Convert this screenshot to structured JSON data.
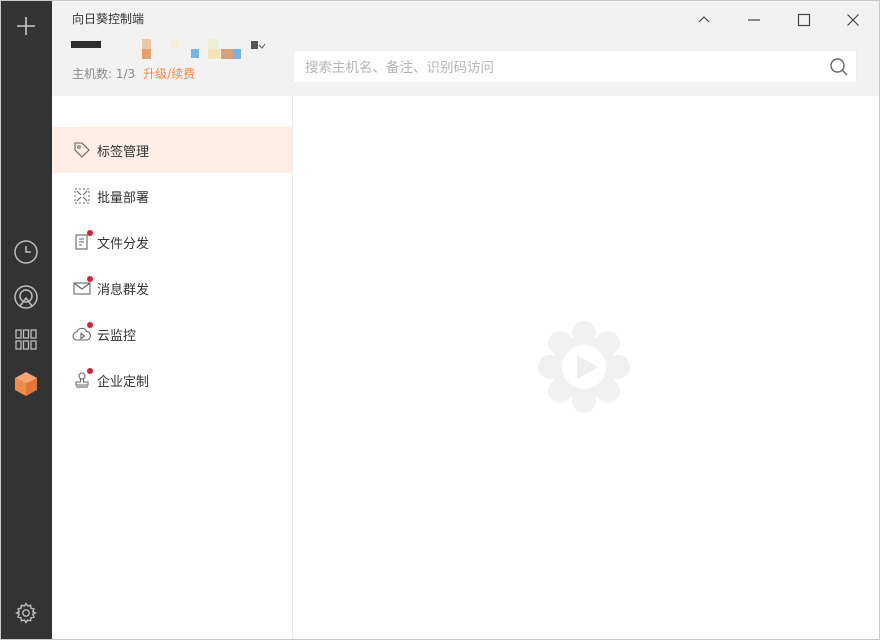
{
  "window": {
    "title": "向日葵控制端"
  },
  "rail": {
    "items": [
      {
        "icon": "plus-icon"
      },
      {
        "icon": "clock-icon"
      },
      {
        "icon": "remote-desktop-icon"
      },
      {
        "icon": "apps-grid-icon"
      },
      {
        "icon": "cube-icon",
        "active": true
      },
      {
        "icon": "gear-icon"
      }
    ],
    "active_color": "#f08d49"
  },
  "header": {
    "host_count_label": "主机数: 1/3",
    "upgrade_label": "升级/续费",
    "search_placeholder": "搜索主机名、备注、识别码访问"
  },
  "menu": {
    "items": [
      {
        "label": "标签管理",
        "icon": "tag-icon",
        "active": true,
        "badge": false
      },
      {
        "label": "批量部署",
        "icon": "batch-deploy-icon",
        "active": false,
        "badge": false
      },
      {
        "label": "文件分发",
        "icon": "file-icon",
        "active": false,
        "badge": true
      },
      {
        "label": "消息群发",
        "icon": "mail-icon",
        "active": false,
        "badge": true
      },
      {
        "label": "云监控",
        "icon": "cloud-play-icon",
        "active": false,
        "badge": true
      },
      {
        "label": "企业定制",
        "icon": "stamp-icon",
        "active": false,
        "badge": true
      }
    ]
  },
  "colors": {
    "rail_bg": "#333333",
    "accent": "#ee8a4a",
    "active_row_bg": "#fdede5",
    "badge_dot": "#d81e3a"
  }
}
